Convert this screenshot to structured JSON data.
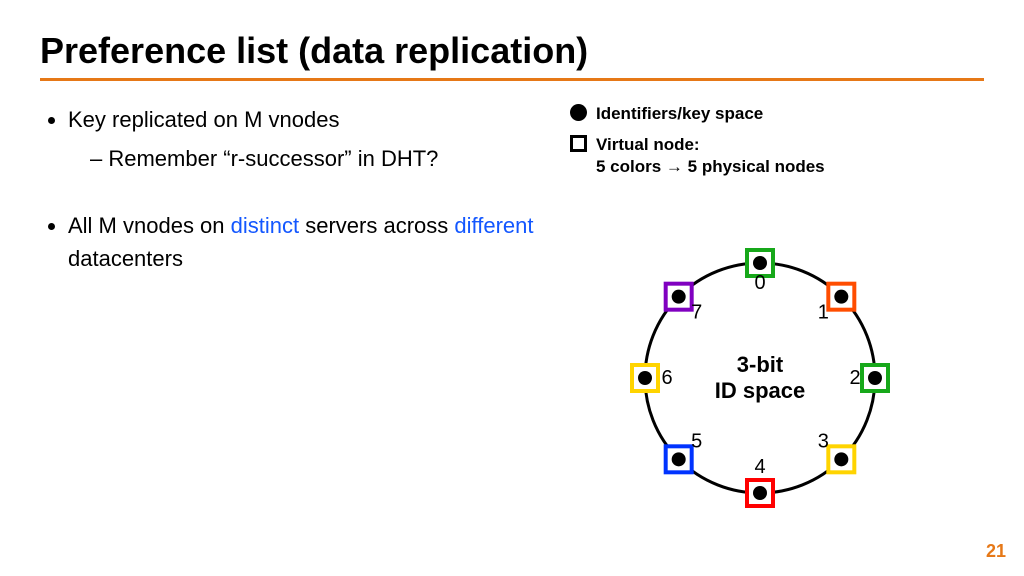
{
  "title": "Preference list (data replication)",
  "accent_color": "#e67817",
  "keyword_color": "#1357ff",
  "page_number": "21",
  "bullets": [
    {
      "text": "Key replicated on M vnodes",
      "sub": [
        "Remember “r-successor” in DHT?"
      ]
    },
    {
      "segments": [
        {
          "t": "All M vnodes on "
        },
        {
          "t": "distinct",
          "kw": true
        },
        {
          "t": " servers across "
        },
        {
          "t": "different",
          "kw": true
        },
        {
          "t": " datacenters"
        }
      ]
    }
  ],
  "legend": {
    "circle": "Identifiers/key space",
    "square_line1": "Virtual node:",
    "square_line2": "5 colors → 5 physical nodes"
  },
  "ring": {
    "center_line1": "3-bit",
    "center_line2": "ID space",
    "node_colors": {
      "green": "#17a81a",
      "orange": "#ff4d00",
      "yellow": "#ffd400",
      "blue": "#0033ff",
      "red": "#ff0000",
      "purple": "#8000c0"
    },
    "nodes": [
      {
        "id": "0",
        "angle_deg": -90,
        "color": "green",
        "label_dx": 0,
        "label_dy": 26
      },
      {
        "id": "1",
        "angle_deg": -45,
        "color": "orange",
        "label_dx": -18,
        "label_dy": 22
      },
      {
        "id": "2",
        "angle_deg": 0,
        "color": "green",
        "label_dx": -20,
        "label_dy": 6
      },
      {
        "id": "3",
        "angle_deg": 45,
        "color": "yellow",
        "label_dx": -18,
        "label_dy": -12
      },
      {
        "id": "4",
        "angle_deg": 90,
        "color": "red",
        "label_dx": 0,
        "label_dy": -20
      },
      {
        "id": "5",
        "angle_deg": 135,
        "color": "blue",
        "label_dx": 18,
        "label_dy": -12
      },
      {
        "id": "6",
        "angle_deg": 180,
        "color": "yellow",
        "label_dx": 22,
        "label_dy": 6
      },
      {
        "id": "7",
        "angle_deg": -135,
        "color": "purple",
        "label_dx": 18,
        "label_dy": 22
      }
    ]
  }
}
